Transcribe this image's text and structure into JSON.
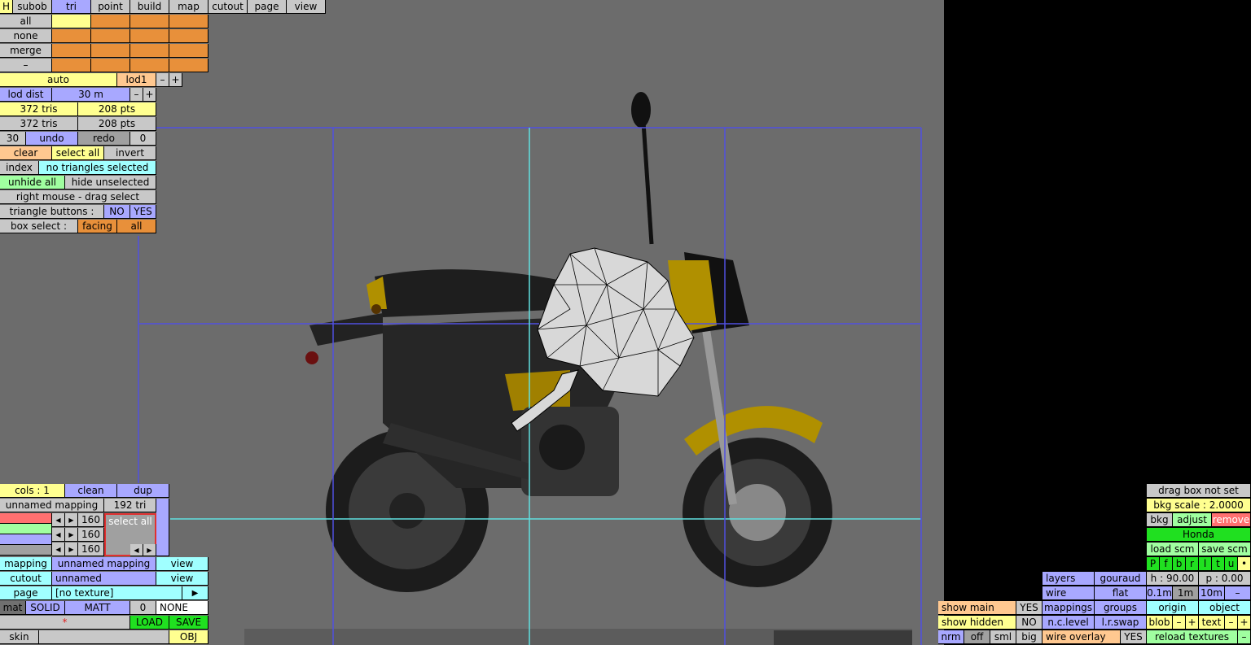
{
  "menu": {
    "h": "H",
    "items": [
      "subob",
      "tri",
      "point",
      "build",
      "map",
      "cutout",
      "page",
      "view"
    ]
  },
  "select_rows": [
    "all",
    "none",
    "merge",
    "–"
  ],
  "lod": {
    "auto": "auto",
    "level": "lod1",
    "minus": "–",
    "plus": "+"
  },
  "lod_dist": {
    "label": "lod dist",
    "value": "30 m",
    "minus": "–",
    "plus": "+"
  },
  "counts": [
    {
      "tris": "372 tris",
      "pts": "208 pts"
    },
    {
      "tris": "372 tris",
      "pts": "208 pts"
    }
  ],
  "history": {
    "steps": "30",
    "undo": "undo",
    "redo": "redo",
    "redo_count": "0"
  },
  "selection": {
    "clear": "clear",
    "select_all": "select all",
    "invert": "invert"
  },
  "index": {
    "label": "index",
    "value": "no triangles selected"
  },
  "hide": {
    "unhide_all": "unhide all",
    "hide_unselected": "hide unselected"
  },
  "hint": "right mouse - drag select",
  "tri_buttons": {
    "label": "triangle buttons :",
    "no": "NO",
    "yes": "YES"
  },
  "box_select": {
    "label": "box select :",
    "facing": "facing",
    "all": "all"
  },
  "cols": {
    "label": "cols : 1",
    "clean": "clean",
    "dup": "dup"
  },
  "mapping_header": {
    "name": "unnamed mapping",
    "tri": "192 tri"
  },
  "color_values": [
    "160",
    "160",
    "160"
  ],
  "select_all_box": "select all",
  "mapping_rows": [
    {
      "label": "mapping",
      "value": "unnamed mapping",
      "action": "view"
    },
    {
      "label": "cutout",
      "value": "unnamed",
      "action": "view"
    },
    {
      "label": "page",
      "value": "[no texture]",
      "action": "▶"
    }
  ],
  "mat": {
    "label": "mat",
    "solid": "SOLID",
    "matt": "MATT",
    "num": "0",
    "name": "NONE"
  },
  "file": {
    "star": "*",
    "load": "LOAD",
    "save": "SAVE"
  },
  "skin": {
    "label": "skin",
    "obj": "OBJ"
  },
  "right_panel": {
    "drag_box": "drag box not set",
    "bkg_scale": "bkg scale : 2.0000",
    "bkg": "bkg",
    "adjust": "adjust",
    "remove": "remove",
    "name": "Honda",
    "load_scm": "load scm",
    "save_scm": "save scm",
    "flags": [
      "P",
      "f",
      "b",
      "r",
      "l",
      "t",
      "u",
      "•"
    ],
    "h": "h : 90.00",
    "p": "p : 0.00",
    "steps": [
      "0.1m",
      "1m",
      "10m",
      "–"
    ],
    "origin": "origin",
    "object": "object",
    "blob": "blob",
    "text": "text",
    "minus": "–",
    "plus": "+",
    "reload": "reload textures",
    "reload_minus": "–"
  },
  "display": {
    "layers": "layers",
    "gouraud": "gouraud",
    "wire": "wire",
    "flat": "flat",
    "mappings": "mappings",
    "groups": "groups",
    "nclevel": "n.c.level",
    "lrswap": "l.r.swap",
    "wire_overlay": "wire overlay",
    "wire_overlay_val": "YES",
    "show_main": "show main",
    "show_main_val": "YES",
    "show_hidden": "show hidden",
    "show_hidden_val": "NO",
    "nrm": "nrm",
    "off": "off",
    "sml": "sml",
    "big": "big"
  },
  "colors": {
    "viewport_bg": "#6c6c6c",
    "grid_blue": "#5050e0",
    "grid_cyan": "#60e0e0"
  }
}
